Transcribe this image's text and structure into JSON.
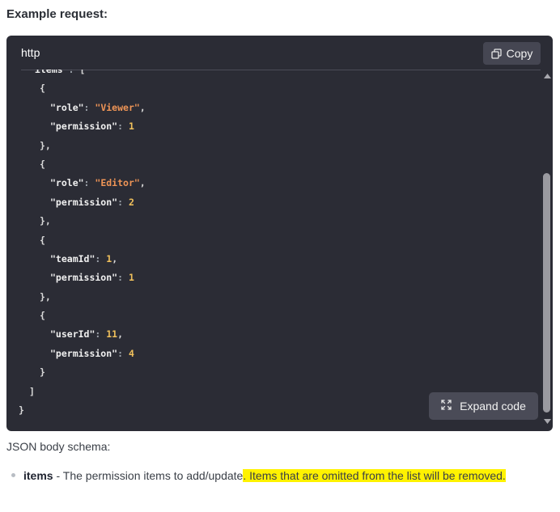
{
  "heading": "Example request:",
  "code_block": {
    "language": "http",
    "copy_label": "Copy",
    "expand_label": "Expand code",
    "lines": [
      {
        "indent": 2,
        "tokens": [
          {
            "t": "key",
            "v": "\"items\""
          },
          {
            "t": "colon",
            "v": ": "
          },
          {
            "t": "punc",
            "v": "["
          }
        ]
      },
      {
        "indent": 4,
        "tokens": [
          {
            "t": "punc",
            "v": "{"
          }
        ]
      },
      {
        "indent": 6,
        "tokens": [
          {
            "t": "key",
            "v": "\"role\""
          },
          {
            "t": "colon",
            "v": ": "
          },
          {
            "t": "str",
            "v": "\"Viewer\""
          },
          {
            "t": "punc",
            "v": ","
          }
        ]
      },
      {
        "indent": 6,
        "tokens": [
          {
            "t": "key",
            "v": "\"permission\""
          },
          {
            "t": "colon",
            "v": ": "
          },
          {
            "t": "num",
            "v": "1"
          }
        ]
      },
      {
        "indent": 4,
        "tokens": [
          {
            "t": "punc",
            "v": "},"
          }
        ]
      },
      {
        "indent": 4,
        "tokens": [
          {
            "t": "punc",
            "v": "{"
          }
        ]
      },
      {
        "indent": 6,
        "tokens": [
          {
            "t": "key",
            "v": "\"role\""
          },
          {
            "t": "colon",
            "v": ": "
          },
          {
            "t": "str",
            "v": "\"Editor\""
          },
          {
            "t": "punc",
            "v": ","
          }
        ]
      },
      {
        "indent": 6,
        "tokens": [
          {
            "t": "key",
            "v": "\"permission\""
          },
          {
            "t": "colon",
            "v": ": "
          },
          {
            "t": "num",
            "v": "2"
          }
        ]
      },
      {
        "indent": 4,
        "tokens": [
          {
            "t": "punc",
            "v": "},"
          }
        ]
      },
      {
        "indent": 4,
        "tokens": [
          {
            "t": "punc",
            "v": "{"
          }
        ]
      },
      {
        "indent": 6,
        "tokens": [
          {
            "t": "key",
            "v": "\"teamId\""
          },
          {
            "t": "colon",
            "v": ": "
          },
          {
            "t": "num",
            "v": "1"
          },
          {
            "t": "punc",
            "v": ","
          }
        ]
      },
      {
        "indent": 6,
        "tokens": [
          {
            "t": "key",
            "v": "\"permission\""
          },
          {
            "t": "colon",
            "v": ": "
          },
          {
            "t": "num",
            "v": "1"
          }
        ]
      },
      {
        "indent": 4,
        "tokens": [
          {
            "t": "punc",
            "v": "},"
          }
        ]
      },
      {
        "indent": 4,
        "tokens": [
          {
            "t": "punc",
            "v": "{"
          }
        ]
      },
      {
        "indent": 6,
        "tokens": [
          {
            "t": "key",
            "v": "\"userId\""
          },
          {
            "t": "colon",
            "v": ": "
          },
          {
            "t": "num",
            "v": "11"
          },
          {
            "t": "punc",
            "v": ","
          }
        ]
      },
      {
        "indent": 6,
        "tokens": [
          {
            "t": "key",
            "v": "\"permission\""
          },
          {
            "t": "colon",
            "v": ": "
          },
          {
            "t": "num",
            "v": "4"
          }
        ]
      },
      {
        "indent": 4,
        "tokens": [
          {
            "t": "punc",
            "v": "}"
          }
        ]
      },
      {
        "indent": 2,
        "tokens": [
          {
            "t": "punc",
            "v": "]"
          }
        ]
      },
      {
        "indent": 0,
        "tokens": [
          {
            "t": "punc",
            "v": "}"
          }
        ]
      }
    ]
  },
  "schema_label": "JSON body schema:",
  "schema_items": [
    {
      "name": "items",
      "separator": " - ",
      "description": "The permission items to add/update",
      "highlighted": ". Items that are omitted from the list will be removed."
    }
  ],
  "colors": {
    "code_bg": "#2b2c35",
    "string": "#ee9456",
    "number": "#f1c15c",
    "highlight": "#fff200"
  },
  "icons": {
    "copy": "copy-icon",
    "expand": "expand-icon",
    "scroll_up": "chevron-up-icon",
    "scroll_down": "chevron-down-icon"
  }
}
